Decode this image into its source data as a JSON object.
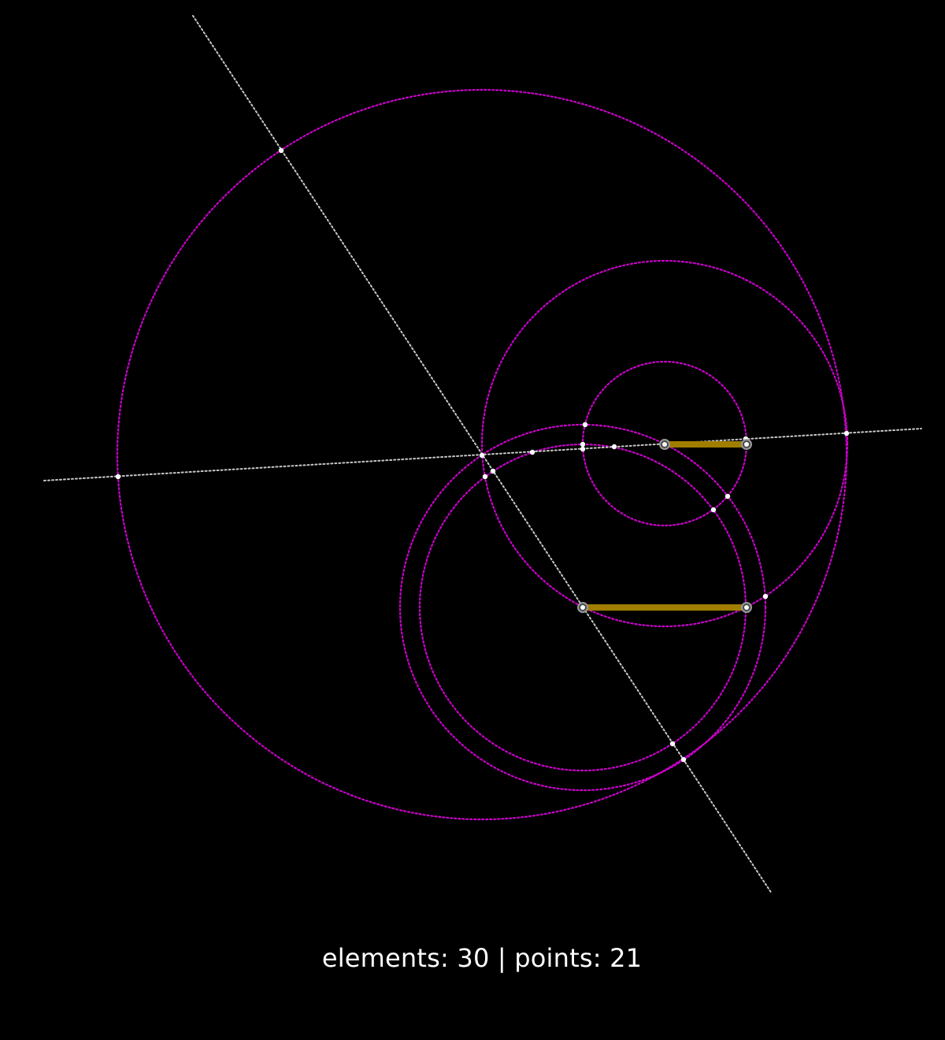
{
  "status": {
    "elements_label": "elements",
    "elements_count": 30,
    "points_label": "points",
    "points_count": 21,
    "text": "elements: 30 | points: 21"
  },
  "colors": {
    "background": "#000000",
    "circle": "#cc00cc",
    "line": "#c8c8c8",
    "segment": "#a07e00",
    "point": "#ffffff",
    "handle_ring": "#9a9a9a",
    "text": "#ffffff"
  },
  "icons": {
    "free_point": "ringed-dot",
    "construction_point": "dot"
  }
}
